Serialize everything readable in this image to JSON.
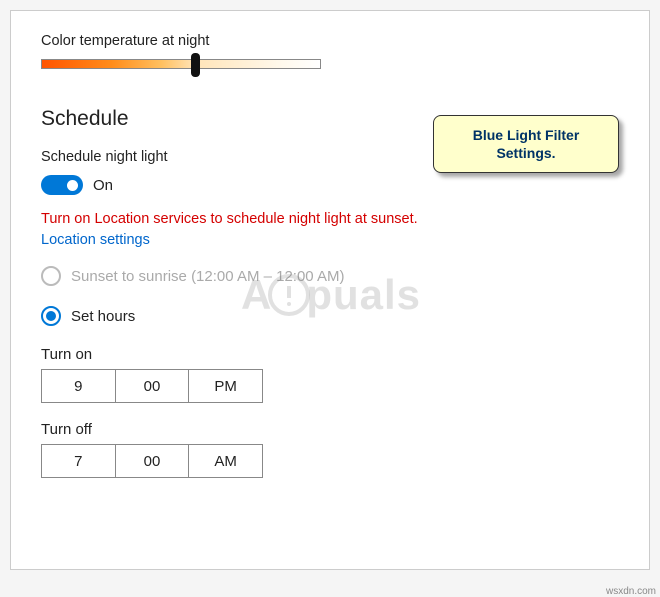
{
  "color_temp": {
    "label": "Color temperature at night"
  },
  "schedule": {
    "heading": "Schedule",
    "toggle_label": "Schedule night light",
    "toggle_state": "On",
    "warning": "Turn on Location services to schedule night light at sunset.",
    "link": "Location settings",
    "option_sunset": "Sunset to sunrise (12:00 AM – 12:00 AM)",
    "option_sethours": "Set hours"
  },
  "turn_on": {
    "label": "Turn on",
    "hour": "9",
    "minute": "00",
    "ampm": "PM"
  },
  "turn_off": {
    "label": "Turn off",
    "hour": "7",
    "minute": "00",
    "ampm": "AM"
  },
  "callout": {
    "line1": "Blue Light Filter",
    "line2": "Settings."
  },
  "watermark": {
    "pre": "A",
    "post": "puals"
  },
  "credit": "wsxdn.com"
}
